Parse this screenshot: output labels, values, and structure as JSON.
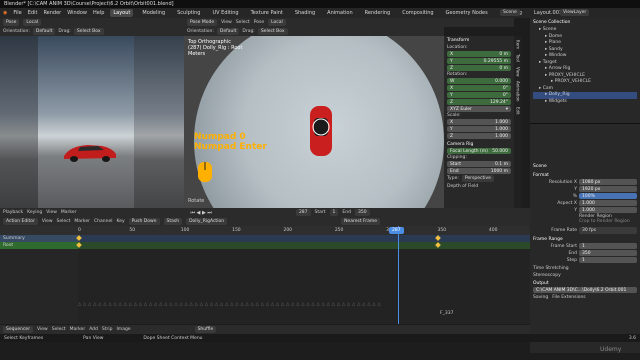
{
  "window_title": "Blender* [C:\\CAM ANIM 3D\\Course\\Project\\6.2 Orbit\\Orbit001.blend]",
  "menu": [
    "File",
    "Edit",
    "Render",
    "Window",
    "Help"
  ],
  "workspaces": [
    "Layout",
    "Modeling",
    "Sculpting",
    "UV Editing",
    "Texture Paint",
    "Shading",
    "Animation",
    "Rendering",
    "Compositing",
    "Geometry Nodes",
    "Scripting",
    "Layout.001"
  ],
  "active_workspace": "Layout",
  "scene_label": "Scene",
  "view_layer_label": "ViewLayer",
  "left_viewport": {
    "mode": "Pose",
    "transform": "Local",
    "orientation": "Orientation:",
    "orientation_value": "Default",
    "drag": "Drag:",
    "select": "Select Box"
  },
  "top_viewport": {
    "mode": "Pose Mode",
    "view": "View",
    "select": "Select",
    "pose": "Pose",
    "transform": "Local",
    "orientation": "Orientation:",
    "orientation_value": "Default",
    "drag": "Drag:",
    "select_box": "Select Box",
    "view_name": "Top Orthographic",
    "object_line": "(287) Dolly_Rig : Root",
    "units": "Meters",
    "overlay_line1": "Numpad 0",
    "overlay_line2": "Numpad Enter",
    "status_hint": "Rotate"
  },
  "n_panel": {
    "title": "Transform",
    "location_label": "Location:",
    "location": [
      {
        "axis": "X",
        "value": "0 m"
      },
      {
        "axis": "Y",
        "value": "0.29555 m"
      },
      {
        "axis": "Z",
        "value": "0 m"
      }
    ],
    "rotation_label": "Rotation:",
    "rotation": [
      {
        "axis": "W",
        "value": "0.000"
      },
      {
        "axis": "X",
        "value": "0°"
      },
      {
        "axis": "Y",
        "value": "0°"
      },
      {
        "axis": "Z",
        "value": "129.24°"
      }
    ],
    "rotation_mode": "XYZ Euler",
    "scale_label": "Scale:",
    "scale": [
      {
        "axis": "X",
        "value": "1.000"
      },
      {
        "axis": "Y",
        "value": "1.000"
      },
      {
        "axis": "Z",
        "value": "1.000"
      }
    ],
    "camera_header": "Camera Rig",
    "focal_label": "Focal Length (m)",
    "focal_value": "50.000",
    "clipping_label": "Clipping:",
    "clip_start_label": "Start",
    "clip_start": "0.1 m",
    "clip_end_label": "End",
    "clip_end": "1000 m",
    "type_label": "Type:",
    "type_value": "Perspective",
    "dof_label": "Depth of Field"
  },
  "tabs_vertical": [
    "Item",
    "Tool",
    "View",
    "Animation",
    "Edit"
  ],
  "outliner": {
    "title": "Scene Collection",
    "items": [
      {
        "label": "Scene",
        "indent": 1
      },
      {
        "label": "Dome",
        "indent": 2
      },
      {
        "label": "Plane",
        "indent": 2
      },
      {
        "label": "Sandy",
        "indent": 2
      },
      {
        "label": "Window",
        "indent": 2
      },
      {
        "label": "Target",
        "indent": 1
      },
      {
        "label": "Arrow Rig",
        "indent": 2
      },
      {
        "label": "PROXY_VEHICLE",
        "indent": 2
      },
      {
        "label": "PROXY_VEHICLE",
        "indent": 3
      },
      {
        "label": "Cam",
        "indent": 1
      },
      {
        "label": "Dolly_Rig",
        "indent": 2
      },
      {
        "label": "Widgets",
        "indent": 2
      }
    ],
    "selected_index": 10
  },
  "properties": {
    "scene_title": "Scene",
    "format_header": "Format",
    "res_x_label": "Resolution X",
    "res_x": "1080 px",
    "res_y_label": "Y",
    "res_y": "1920 px",
    "pct_label": "%",
    "pct": "100%",
    "aspect_x_label": "Aspect X",
    "aspect_x": "1.000",
    "aspect_y_label": "Y",
    "aspect_y": "1.000",
    "render_region": "Render Region",
    "crop_region": "Crop to Render Region",
    "frame_rate_label": "Frame Rate",
    "frame_rate": "30 fps",
    "frame_range_header": "Frame Range",
    "frame_start_label": "Frame Start",
    "frame_start": "1",
    "end_label": "End",
    "end": "350",
    "step_label": "Step",
    "step": "1",
    "time_stretching": "Time Stretching",
    "stereoscopy": "Stereoscopy",
    "output_header": "Output",
    "output_path": "C:\\CAM ANIM 3D\\C...\\Dolly\\6.2 Orbit.001",
    "saving_label": "Saving",
    "file_extensions": "File Extensions"
  },
  "timeline_header": {
    "playback": "Playback",
    "keying": "Keying",
    "view": "View",
    "marker": "Marker",
    "current_frame": "287",
    "start_label": "Start",
    "start": "1",
    "end_label": "End",
    "end": "350"
  },
  "action_header": {
    "mode": "Action Editor",
    "view": "View",
    "select": "Select",
    "marker": "Marker",
    "channel": "Channel",
    "key": "Key",
    "pivot": "Push Down",
    "stash": "Stash",
    "action": "Dolly_RigAction",
    "snap": "Nearest Frame"
  },
  "ruler_ticks": [
    "0",
    "50",
    "100",
    "150",
    "200",
    "250",
    "300",
    "350",
    "400"
  ],
  "current_frame_marker": "287",
  "channels": [
    {
      "label": "Summary"
    },
    {
      "label": "Root"
    }
  ],
  "bottom_frame_label": "F_337",
  "sequencer_header": {
    "editor": "Sequencer",
    "view": "View",
    "select": "Select",
    "marker": "Marker",
    "add": "Add",
    "strip": "Strip",
    "image": "Image",
    "shuffle": "Shuffle"
  },
  "status_bar": {
    "left": "Select Keyframes",
    "middle": "Pan View",
    "right": "Dope Sheet Context Menu",
    "version": "3.6"
  },
  "watermark": "Udemy"
}
